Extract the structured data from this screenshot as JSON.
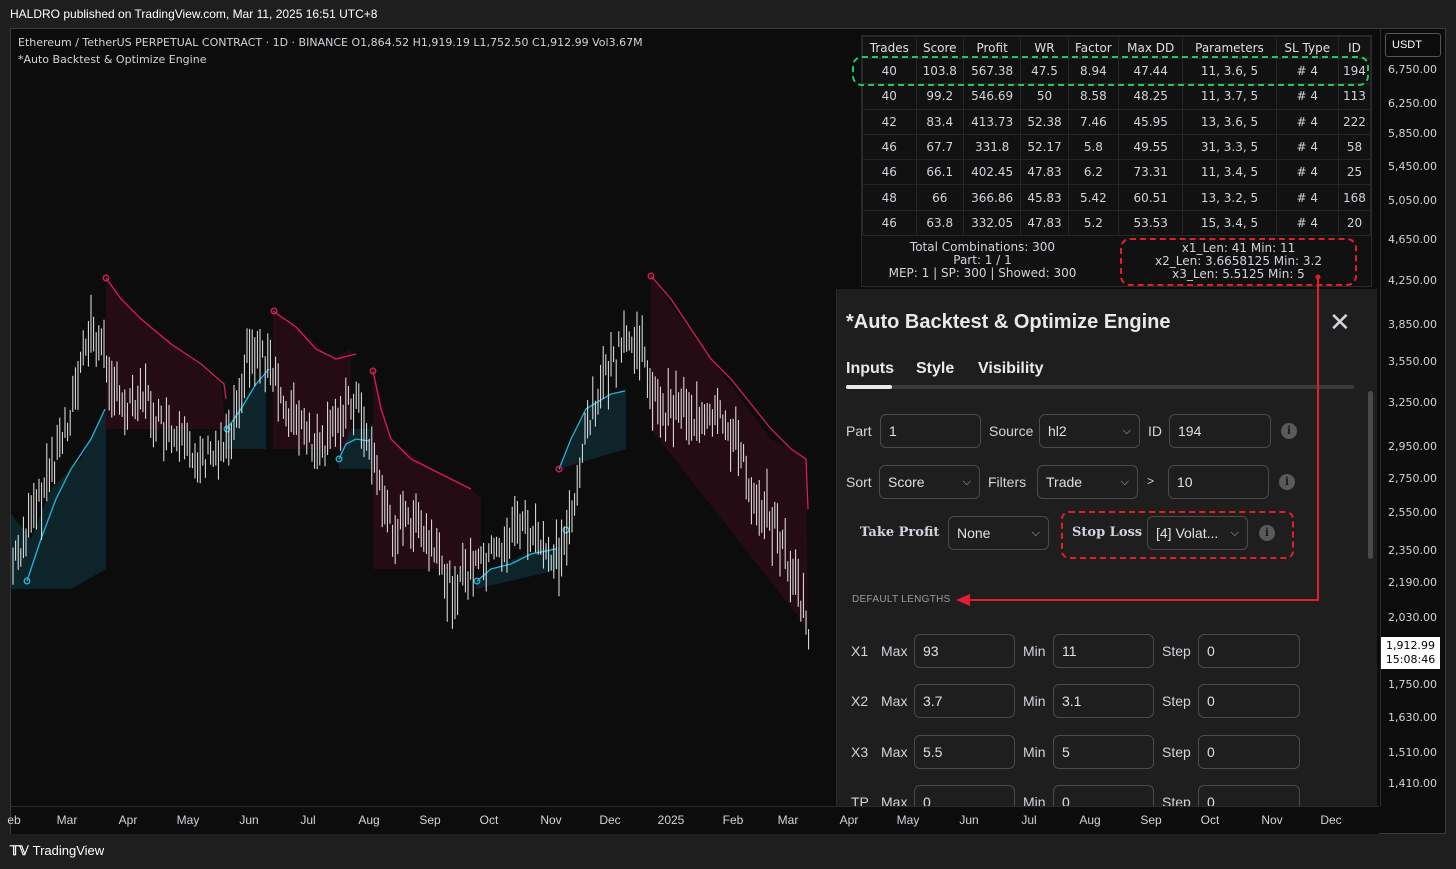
{
  "topbar": {
    "text": "HALDRO published on TradingView.com, Mar 11, 2025 16:51 UTC+8"
  },
  "legend": {
    "line1": "Ethereum / TetherUS PERPETUAL CONTRACT · 1D · BINANCE  O1,864.52  H1,919.19  L1,752.50  C1,912.99  Vol3.67M",
    "line2": "*Auto Backtest & Optimize Engine"
  },
  "yaxis": {
    "currency": "USDT",
    "ticks": [
      "6,750.00",
      "6,250.00",
      "5,850.00",
      "5,450.00",
      "5,050.00",
      "4,650.00",
      "4,250.00",
      "3,850.00",
      "3,550.00",
      "3,250.00",
      "2,950.00",
      "2,750.00",
      "2,550.00",
      "2,350.00",
      "2,190.00",
      "2,030.00",
      "1,750.00",
      "1,630.00",
      "1,510.00",
      "1,410.00"
    ],
    "last_price": "1,912.99",
    "countdown": "15:08:46"
  },
  "xaxis": {
    "ticks": [
      "eb",
      "Mar",
      "Apr",
      "May",
      "Jun",
      "Jul",
      "Aug",
      "Sep",
      "Oct",
      "Nov",
      "Dec",
      "2025",
      "Feb",
      "Mar",
      "Apr",
      "May",
      "Jun",
      "Jul",
      "Aug",
      "Sep",
      "Oct",
      "Nov",
      "Dec"
    ]
  },
  "footer": {
    "brand": "TradingView"
  },
  "results": {
    "headers": [
      "Trades",
      "Score",
      "Profit",
      "WR",
      "Factor",
      "Max DD",
      "Parameters",
      "SL Type",
      "ID"
    ],
    "rows": [
      [
        "40",
        "103.8",
        "567.38",
        "47.5",
        "8.94",
        "47.44",
        "11, 3.6, 5",
        "# 4",
        "194"
      ],
      [
        "40",
        "99.2",
        "546.69",
        "50",
        "8.58",
        "48.25",
        "11, 3.7, 5",
        "# 4",
        "113"
      ],
      [
        "42",
        "83.4",
        "413.73",
        "52.38",
        "7.46",
        "45.95",
        "13, 3.6, 5",
        "# 4",
        "222"
      ],
      [
        "46",
        "67.7",
        "331.8",
        "52.17",
        "5.8",
        "49.55",
        "31, 3.3, 5",
        "# 4",
        "58"
      ],
      [
        "46",
        "66.1",
        "402.45",
        "47.83",
        "6.2",
        "73.31",
        "11, 3.4, 5",
        "# 4",
        "25"
      ],
      [
        "48",
        "66",
        "366.86",
        "45.83",
        "5.42",
        "60.51",
        "13, 3.2, 5",
        "# 4",
        "168"
      ],
      [
        "46",
        "63.8",
        "332.05",
        "47.83",
        "5.2",
        "53.53",
        "15, 3.4, 5",
        "# 4",
        "20"
      ]
    ],
    "summary": [
      "Total Combinations: 300",
      "Part: 1 / 1",
      "MEP: 1 | SP: 300 | Showed: 300"
    ],
    "best": [
      "x1_Len: 41    Min: 11",
      "x2_Len: 3.6658125    Min: 3.2",
      "x3_Len: 5.5125    Min: 5"
    ]
  },
  "dialog": {
    "title": "*Auto Backtest & Optimize Engine",
    "tabs": [
      "Inputs",
      "Style",
      "Visibility"
    ],
    "part_label": "Part",
    "part_value": "1",
    "source_label": "Source",
    "source_value": "hl2",
    "id_label": "ID",
    "id_value": "194",
    "sort_label": "Sort",
    "sort_value": "Score",
    "filters_label": "Filters",
    "filters_value": "Trade",
    "gt_label": ">",
    "filter_threshold": "10",
    "tp_label": "Take Profit",
    "tp_value": "None",
    "sl_label": "Stop Loss",
    "sl_value": "[4] Volat...",
    "section": "DEFAULT LENGTHS",
    "max_label": "Max",
    "min_label": "Min",
    "step_label": "Step",
    "lengths": [
      {
        "name": "X1",
        "max": "93",
        "min": "11",
        "step": "0"
      },
      {
        "name": "X2",
        "max": "3.7",
        "min": "3.1",
        "step": "0"
      },
      {
        "name": "X3",
        "max": "5.5",
        "min": "5",
        "step": "0"
      },
      {
        "name": "TP",
        "max": "0",
        "min": "0",
        "step": "0"
      }
    ]
  },
  "colors": {
    "background": "#0c0c0c",
    "bull_band": "#1fb5d6",
    "bear_band": "#d81b60",
    "highlight_green": "#22c55e",
    "highlight_red": "#e11d2e"
  }
}
